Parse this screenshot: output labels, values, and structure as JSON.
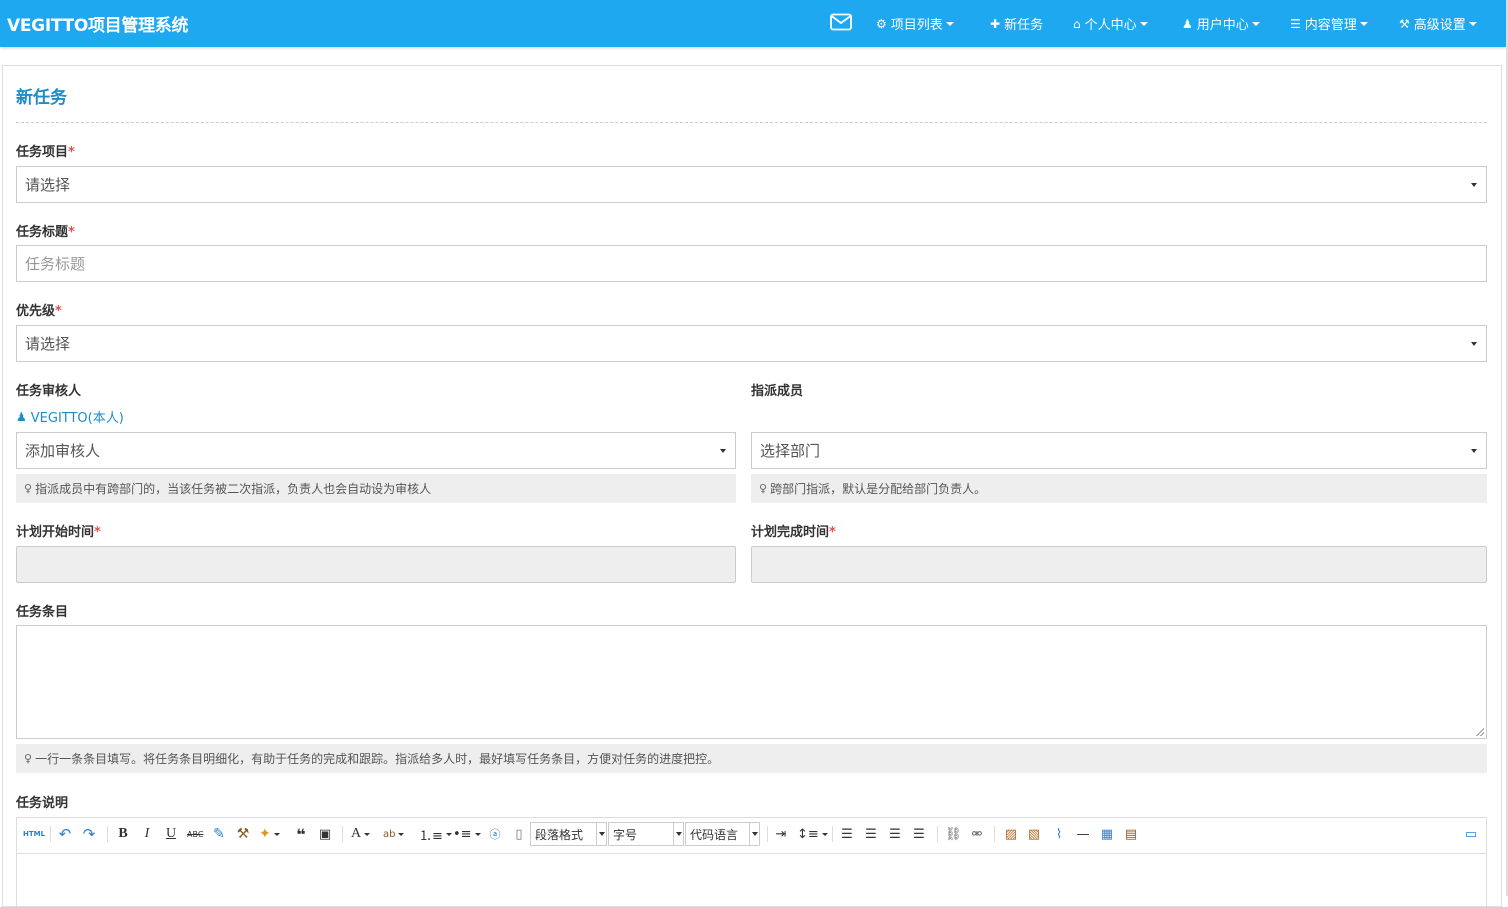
{
  "navbar": {
    "brand": "VEGITTO项目管理系统",
    "items": [
      {
        "icon": "cubes-icon",
        "glyph": "⚙",
        "label": "项目列表",
        "dropdown": true
      },
      {
        "icon": "plus-icon",
        "glyph": "✚",
        "label": "新任务",
        "dropdown": false
      },
      {
        "icon": "home-icon",
        "glyph": "⌂",
        "label": "个人中心",
        "dropdown": true
      },
      {
        "icon": "user-icon",
        "glyph": "♟",
        "label": "用户中心",
        "dropdown": true
      },
      {
        "icon": "database-icon",
        "glyph": "☰",
        "label": "内容管理",
        "dropdown": true
      },
      {
        "icon": "wrench-icon",
        "glyph": "⚒",
        "label": "高级设置",
        "dropdown": true
      }
    ],
    "mail_icon": "envelope-icon"
  },
  "page": {
    "title": "新任务"
  },
  "form": {
    "project": {
      "label": "任务项目",
      "required": "*",
      "value": "请选择"
    },
    "task_title": {
      "label": "任务标题",
      "required": "*",
      "placeholder": "任务标题"
    },
    "priority": {
      "label": "优先级",
      "required": "*",
      "value": "请选择"
    },
    "reviewer": {
      "label": "任务审核人",
      "self_link": "VEGITTO(本人)",
      "select_value": "添加审核人",
      "hint": "指派成员中有跨部门的，当该任务被二次指派，负责人也会自动设为审核人"
    },
    "assignees": {
      "label": "指派成员",
      "select_value": "选择部门",
      "hint": "跨部门指派，默认是分配给部门负责人。"
    },
    "plan_start": {
      "label": "计划开始时间",
      "required": "*"
    },
    "plan_end": {
      "label": "计划完成时间",
      "required": "*"
    },
    "items": {
      "label": "任务条目",
      "hint": "一行一条条目填写。将任务条目明细化，有助于任务的完成和跟踪。指派给多人时，最好填写任务条目，方便对任务的进度把控。"
    },
    "description": {
      "label": "任务说明",
      "combos": {
        "paragraph": "段落格式",
        "font_size": "字号",
        "code_lang": "代码语言"
      }
    }
  },
  "colors": {
    "navbar": "#1ea8ef",
    "accent": "#1e8cc9",
    "required": "#d9534f"
  }
}
